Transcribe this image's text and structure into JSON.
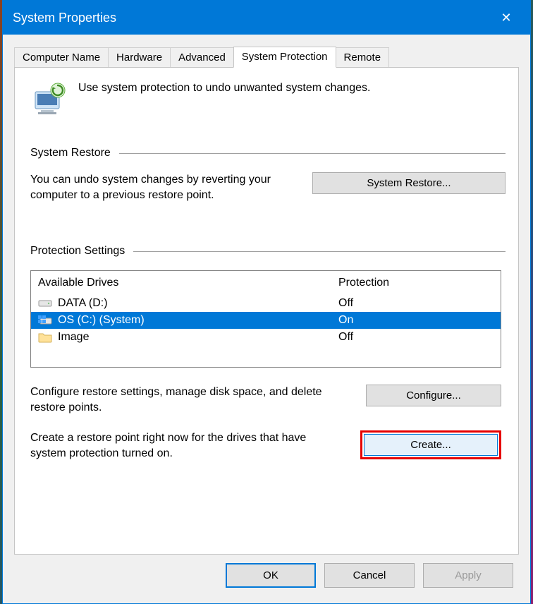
{
  "window": {
    "title": "System Properties"
  },
  "tabs": [
    {
      "label": "Computer Name",
      "active": false
    },
    {
      "label": "Hardware",
      "active": false
    },
    {
      "label": "Advanced",
      "active": false
    },
    {
      "label": "System Protection",
      "active": true
    },
    {
      "label": "Remote",
      "active": false
    }
  ],
  "intro": {
    "text": "Use system protection to undo unwanted system changes."
  },
  "system_restore": {
    "header": "System Restore",
    "desc": "You can undo system changes by reverting your computer to a previous restore point.",
    "button": "System Restore..."
  },
  "protection_settings": {
    "header": "Protection Settings",
    "columns": {
      "drives": "Available Drives",
      "protection": "Protection"
    },
    "rows": [
      {
        "icon": "disk-icon",
        "name": "DATA (D:)",
        "protection": "Off",
        "selected": false
      },
      {
        "icon": "windows-disk-icon",
        "name": "OS (C:) (System)",
        "protection": "On",
        "selected": true
      },
      {
        "icon": "folder-icon",
        "name": "Image",
        "protection": "Off",
        "selected": false
      }
    ],
    "configure": {
      "desc": "Configure restore settings, manage disk space, and delete restore points.",
      "button": "Configure..."
    },
    "create": {
      "desc": "Create a restore point right now for the drives that have system protection turned on.",
      "button": "Create..."
    }
  },
  "footer": {
    "ok": "OK",
    "cancel": "Cancel",
    "apply": "Apply"
  }
}
